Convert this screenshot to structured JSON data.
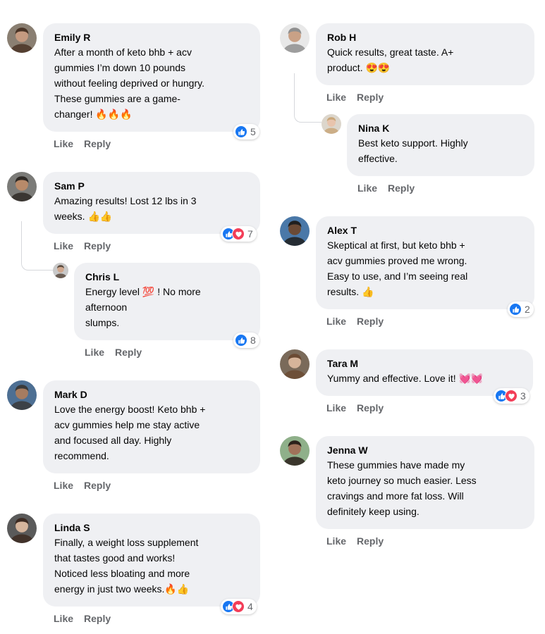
{
  "actions": {
    "like": "Like",
    "reply": "Reply"
  },
  "comments": [
    {
      "name": "Emily R",
      "lines": [
        "After a month of keto bhb + acv",
        "gummies I’m down 10 pounds",
        "without feeling deprived or hungry.",
        "These gummies are a game-",
        "changer! 🔥🔥🔥"
      ],
      "reactions": [
        "like"
      ],
      "count": "5"
    },
    {
      "name": "Sam P",
      "lines": [
        "Amazing results! Lost 12 lbs in 3",
        "weeks. 👍👍"
      ],
      "reactions": [
        "like",
        "love"
      ],
      "count": "7"
    },
    {
      "name": "Chris L",
      "lines": [
        "Energy level 💯 ! No more",
        "afternoon",
        "slumps."
      ],
      "reactions": [
        "like"
      ],
      "count": "8"
    },
    {
      "name": "Mark D",
      "lines": [
        "Love the energy boost! Keto bhb +",
        "acv gummies help me stay active",
        "and focused all day. Highly",
        "recommend."
      ],
      "reactions": [],
      "count": ""
    },
    {
      "name": "Linda S",
      "lines": [
        "Finally, a weight loss supplement",
        "that tastes good and works!",
        "Noticed less bloating and more",
        "energy in just two weeks.🔥👍"
      ],
      "reactions": [
        "like",
        "love"
      ],
      "count": "4"
    },
    {
      "name": "Rob H",
      "lines": [
        "Quick results, great taste. A+",
        "product. 😍😍"
      ],
      "reactions": [],
      "count": ""
    },
    {
      "name": "Nina K",
      "lines": [
        "Best keto support. Highly",
        "effective."
      ],
      "reactions": [],
      "count": ""
    },
    {
      "name": "Alex T",
      "lines": [
        "Skeptical at first, but keto bhb +",
        "acv gummies proved me wrong.",
        "Easy to use, and I’m seeing real",
        "results. 👍"
      ],
      "reactions": [
        "like"
      ],
      "count": "2"
    },
    {
      "name": "Tara M",
      "lines": [
        "Yummy and effective. Love it! 💓💓"
      ],
      "reactions": [
        "like",
        "love"
      ],
      "count": "3"
    },
    {
      "name": "Jenna W",
      "lines": [
        "These gummies have made my",
        "keto journey so much easier. Less",
        "cravings and more fat loss. Will",
        "definitely keep using."
      ],
      "reactions": [],
      "count": ""
    }
  ],
  "colors": {
    "bubble": "#eff0f3",
    "like_blue": "#1877f2",
    "love_red": "#f33e58",
    "action_gray": "#65676b"
  }
}
